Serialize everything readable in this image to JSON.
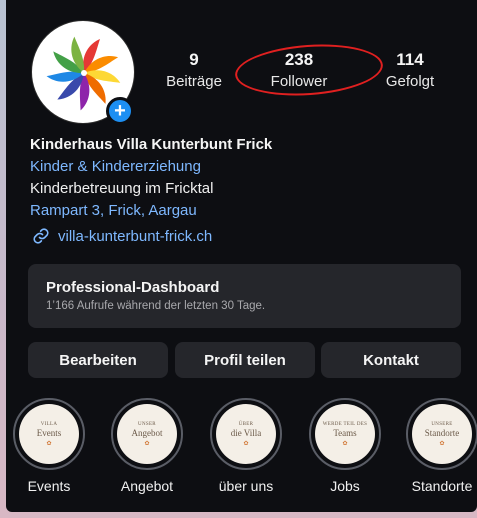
{
  "profile": {
    "stats": {
      "posts": {
        "value": "9",
        "label": "Beiträge"
      },
      "followers": {
        "value": "238",
        "label": "Follower"
      },
      "following": {
        "value": "114",
        "label": "Gefolgt"
      }
    },
    "name": "Kinderhaus Villa Kunterbunt Frick",
    "category": "Kinder & Kindererziehung",
    "description": "Kinderbetreuung im Fricktal",
    "address": "Rampart 3, Frick, Aargau",
    "website": "villa-kunterbunt-frick.ch",
    "add_icon": "plus"
  },
  "dashboard": {
    "title": "Professional-Dashboard",
    "subtitle": "1’166 Aufrufe während der letzten 30 Tage."
  },
  "actions": {
    "edit": "Bearbeiten",
    "share": "Profil teilen",
    "contact": "Kontakt"
  },
  "highlights": [
    {
      "small": "Villa",
      "big": "Events",
      "caption": "Events"
    },
    {
      "small": "Unser",
      "big": "Angebot",
      "caption": "Angebot"
    },
    {
      "small": "Über",
      "big": "die Villa",
      "caption": "über uns"
    },
    {
      "small": "Werde Teil des",
      "big": "Teams",
      "caption": "Jobs"
    },
    {
      "small": "Unsere",
      "big": "Standorte",
      "caption": "Standorte"
    }
  ],
  "colors": {
    "background": "#0d0e12",
    "card": "#25262b",
    "link": "#7eb8ff",
    "accent_blue": "#1d8ff2",
    "annotation_red": "#e02020"
  }
}
